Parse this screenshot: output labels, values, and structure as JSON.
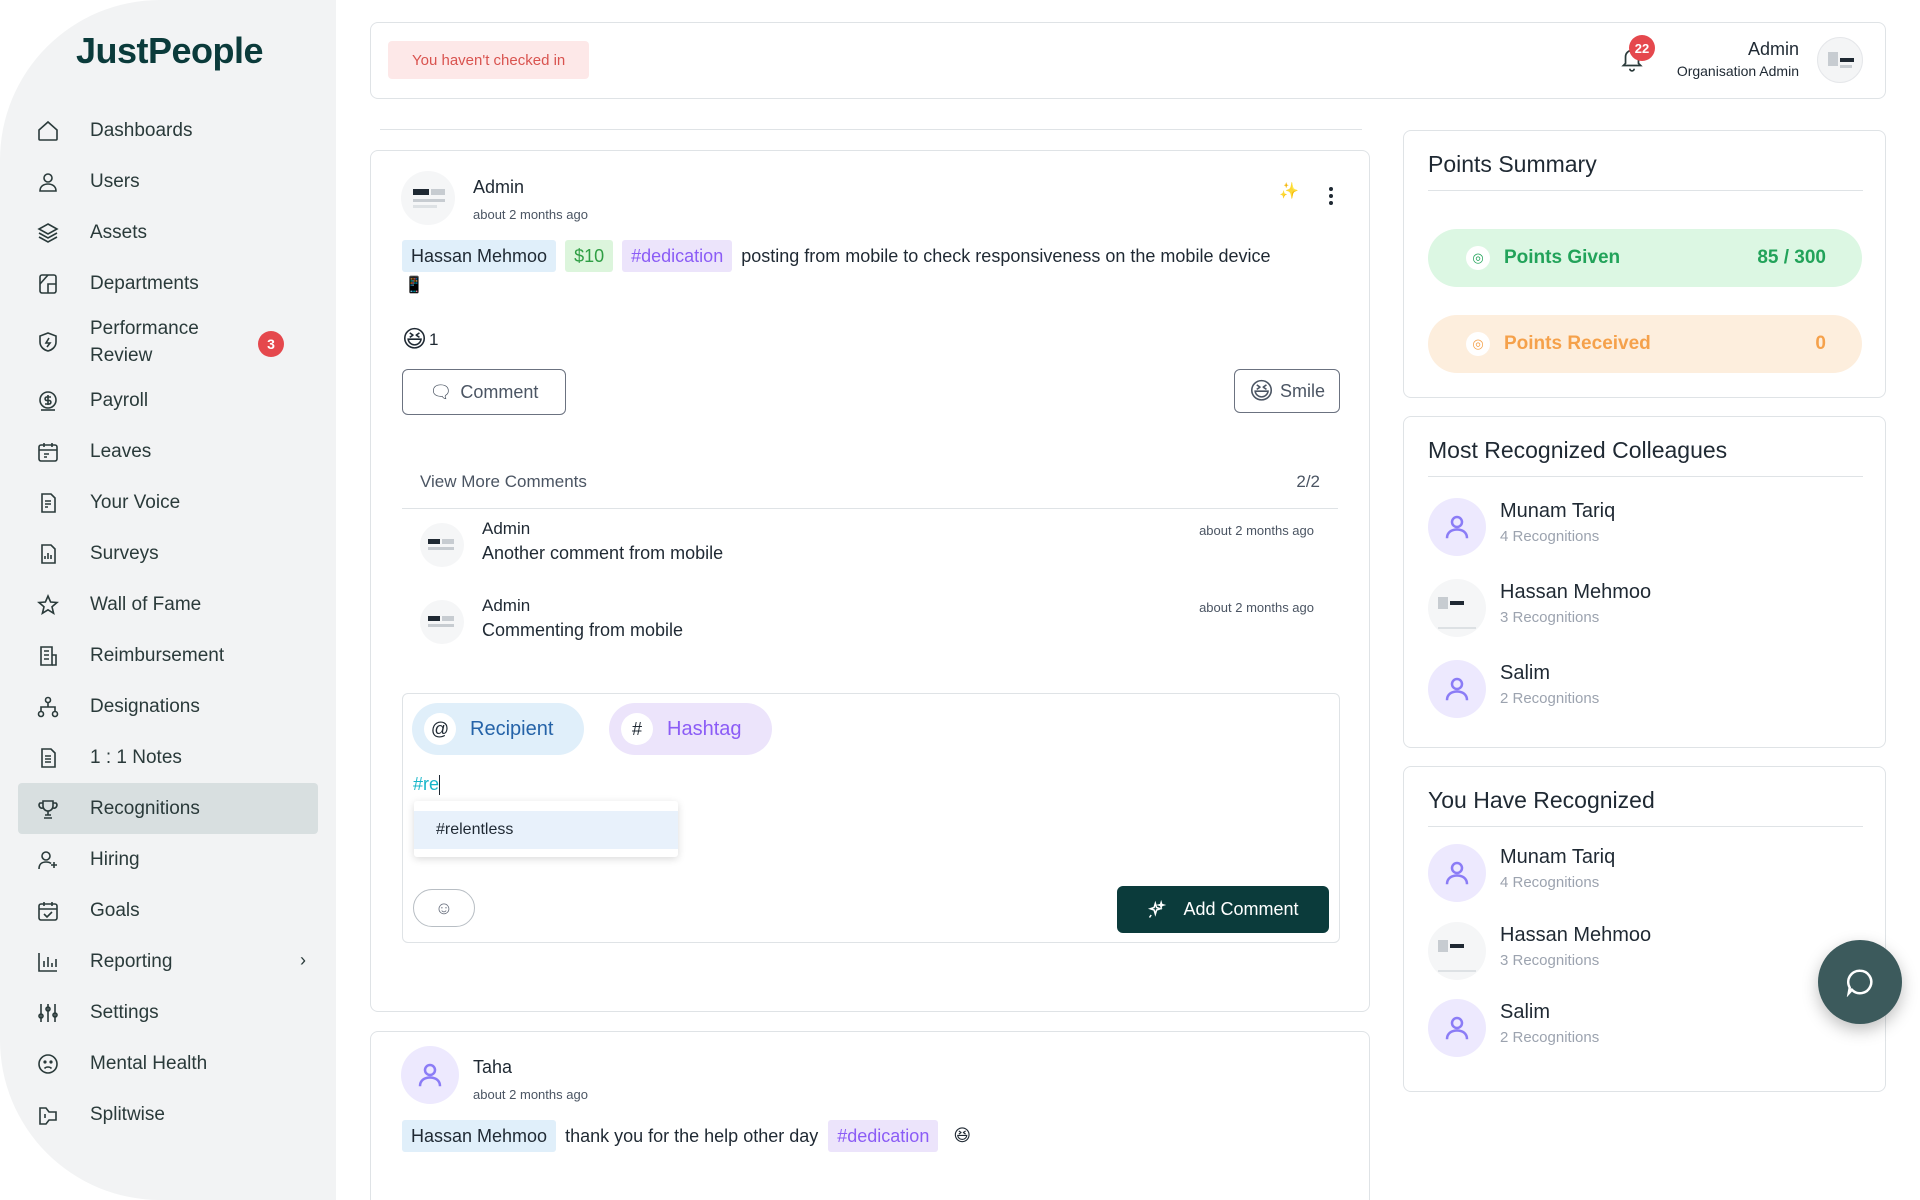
{
  "app": {
    "logo": "JustPeople"
  },
  "sidebar": {
    "items": [
      {
        "label": "Dashboards",
        "icon": "home-icon"
      },
      {
        "label": "Users",
        "icon": "user-icon"
      },
      {
        "label": "Assets",
        "icon": "layers-icon"
      },
      {
        "label": "Departments",
        "icon": "department-icon"
      },
      {
        "label": "Performance Review",
        "icon": "shield-icon",
        "badge": "3"
      },
      {
        "label": "Payroll",
        "icon": "dollar-icon"
      },
      {
        "label": "Leaves",
        "icon": "calendar-edit-icon"
      },
      {
        "label": "Your Voice",
        "icon": "doc-edit-icon"
      },
      {
        "label": "Surveys",
        "icon": "survey-icon"
      },
      {
        "label": "Wall of Fame",
        "icon": "star-icon"
      },
      {
        "label": "Reimbursement",
        "icon": "receipt-icon"
      },
      {
        "label": "Designations",
        "icon": "hierarchy-icon"
      },
      {
        "label": "1 : 1 Notes",
        "icon": "notes-icon"
      },
      {
        "label": "Recognitions",
        "icon": "trophy-icon",
        "active": true
      },
      {
        "label": "Hiring",
        "icon": "user-plus-icon"
      },
      {
        "label": "Goals",
        "icon": "calendar-check-icon"
      },
      {
        "label": "Reporting",
        "icon": "bar-chart-icon",
        "chevron": "›"
      },
      {
        "label": "Settings",
        "icon": "sliders-icon"
      },
      {
        "label": "Mental Health",
        "icon": "sad-face-icon"
      },
      {
        "label": "Splitwise",
        "icon": "split-icon"
      }
    ]
  },
  "topbar": {
    "checkin_status": "You haven't checked in",
    "notification_count": "22",
    "user_name": "Admin",
    "user_role": "Organisation Admin"
  },
  "post1": {
    "author": "Admin",
    "time": "about 2 months ago",
    "recipient": "Hassan Mehmoo",
    "amount": "$10",
    "hashtag": "#dedication",
    "message": "posting from mobile to check responsiveness on the mobile device",
    "message_emoji": "📱",
    "reaction_emoji": "😆",
    "reaction_count": "1",
    "comment_button": "Comment",
    "smile_button": "Smile",
    "view_more": "View More Comments",
    "comment_count": "2/2",
    "comments": [
      {
        "author": "Admin",
        "text": "Another comment from mobile",
        "time": "about 2 months ago"
      },
      {
        "author": "Admin",
        "text": "Commenting from mobile",
        "time": "about 2 months ago"
      }
    ],
    "composer": {
      "recipient_label": "Recipient",
      "hashtag_label": "Hashtag",
      "input_value": "#re",
      "suggestion": "#relentless",
      "add_comment": "Add Comment"
    }
  },
  "post2": {
    "author": "Taha",
    "time": "about 2 months ago",
    "recipient": "Hassan Mehmoo",
    "message": "thank you for the help other day",
    "hashtag": "#dedication",
    "message_emoji": "😆"
  },
  "points_summary": {
    "title": "Points Summary",
    "given_label": "Points Given",
    "given_value": "85 / 300",
    "received_label": "Points Received",
    "received_value": "0"
  },
  "most_recognized": {
    "title": "Most Recognized Colleagues",
    "items": [
      {
        "name": "Munam Tariq",
        "recognitions": "4 Recognitions"
      },
      {
        "name": "Hassan Mehmoo",
        "recognitions": "3 Recognitions"
      },
      {
        "name": "Salim",
        "recognitions": "2 Recognitions"
      }
    ]
  },
  "you_recognized": {
    "title": "You Have Recognized",
    "items": [
      {
        "name": "Munam Tariq",
        "recognitions": "4 Recognitions"
      },
      {
        "name": "Hassan Mehmoo",
        "recognitions": "3 Recognitions"
      },
      {
        "name": "Salim",
        "recognitions": "2 Recognitions"
      }
    ]
  },
  "colors": {
    "brand": "#0b3b3b",
    "active_nav": "#d8dfe0",
    "badge": "#e5484d",
    "points_given": "#22a35a",
    "points_received": "#f5a14b"
  }
}
